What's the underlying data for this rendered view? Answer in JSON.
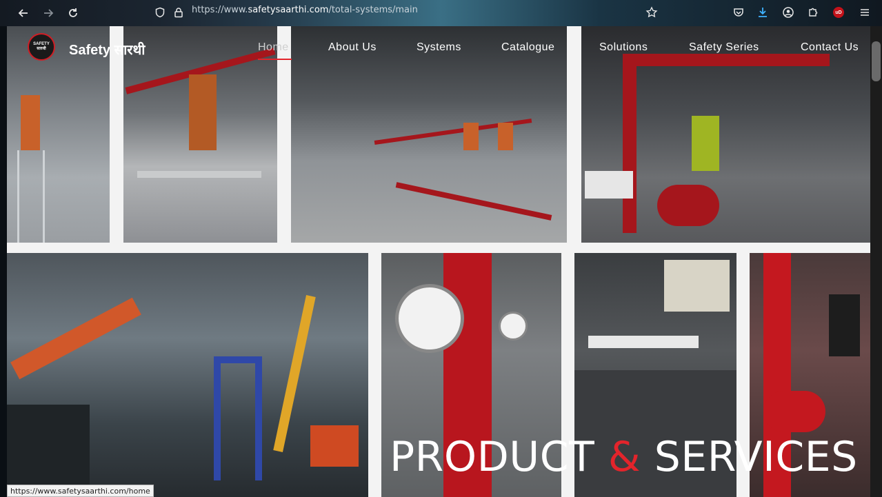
{
  "browser": {
    "url_prefix": "https://www.",
    "url_host": "safetysaarthi.com",
    "url_path": "/total-systems/main",
    "back_icon": "arrow-left-icon",
    "forward_icon": "arrow-right-icon",
    "reload_icon": "reload-icon",
    "shield_icon": "shield-icon",
    "lock_icon": "lock-icon",
    "star_icon": "star-icon",
    "pocket_icon": "pocket-icon",
    "download_icon": "download-icon",
    "account_icon": "account-icon",
    "extensions_icon": "puzzle-icon",
    "ublock_icon": "ublock-icon",
    "ublock_label": "uD",
    "menu_icon": "hamburger-icon"
  },
  "site": {
    "logo_text_top": "SAFETY",
    "logo_text_bottom": "सारथी",
    "brand_name": "Safety सारथी",
    "nav": [
      {
        "label": "Home",
        "active": true
      },
      {
        "label": "About Us"
      },
      {
        "label": "Systems"
      },
      {
        "label": "Catalogue"
      },
      {
        "label": "Solutions"
      },
      {
        "label": "Safety Series"
      },
      {
        "label": "Contact Us"
      }
    ],
    "hero": {
      "word1": "PRODUCT",
      "amp": "&",
      "word2": "SERVICES"
    },
    "accent_color": "#e3242b"
  },
  "statusbar": {
    "link_url": "https://www.safetysaarthi.com/home"
  }
}
